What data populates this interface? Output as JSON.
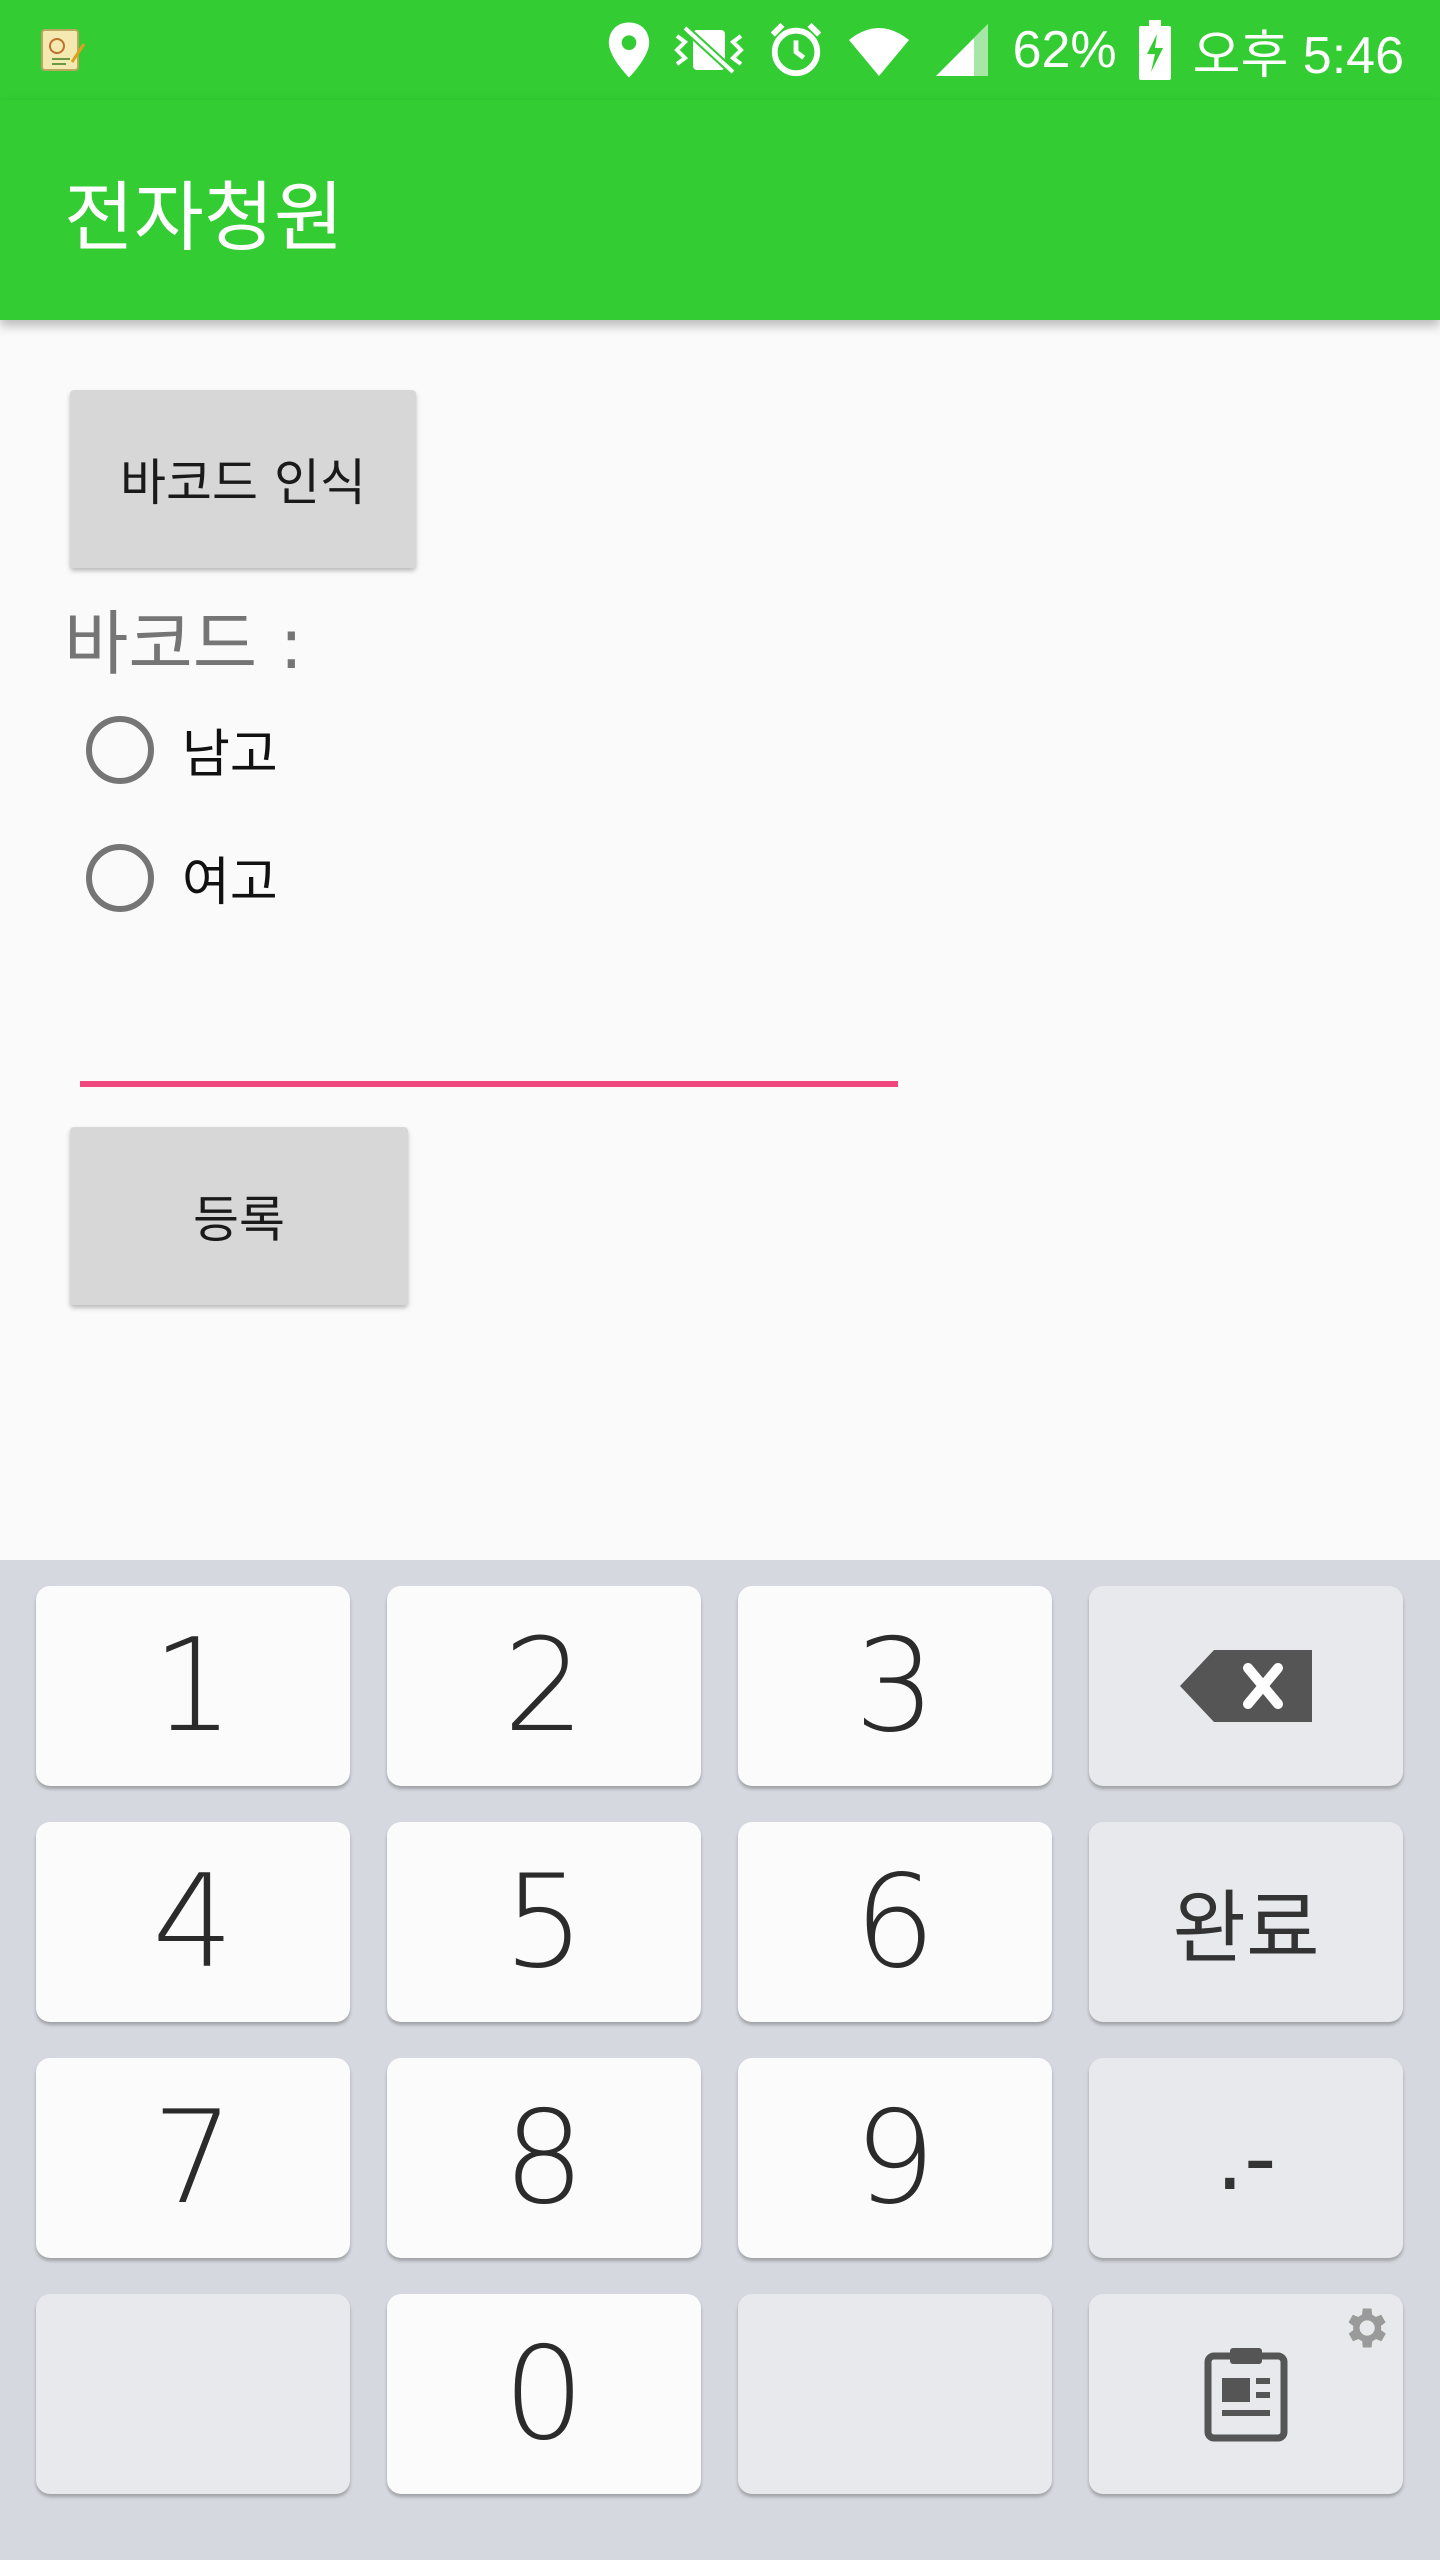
{
  "status_bar": {
    "battery_percent": "62%",
    "time": "오후 5:46",
    "icons": [
      "notification-app-icon",
      "location-icon",
      "vibrate-icon",
      "alarm-icon",
      "wifi-icon",
      "signal-icon",
      "battery-charging-icon"
    ]
  },
  "app_bar": {
    "title": "전자청원"
  },
  "main": {
    "barcode_button": "바코드 인식",
    "barcode_label": "바코드 :",
    "radio_options": [
      {
        "label": "남고",
        "selected": false
      },
      {
        "label": "여고",
        "selected": false
      }
    ],
    "input": {
      "value": "",
      "underline_color": "#f0477e"
    },
    "register_button": "등록"
  },
  "keyboard": {
    "keys": {
      "k1": "1",
      "k2": "2",
      "k3": "3",
      "k4": "4",
      "k5": "5",
      "k6": "6",
      "k7": "7",
      "k8": "8",
      "k9": "9",
      "k0": "0",
      "done": "완료",
      "dotdash": ".-"
    },
    "icons": [
      "backspace-icon",
      "clipboard-icon",
      "settings-icon"
    ]
  },
  "colors": {
    "accent_green": "#33cc33",
    "input_underline": "#f0477e",
    "keyboard_bg": "#d5d8de"
  }
}
